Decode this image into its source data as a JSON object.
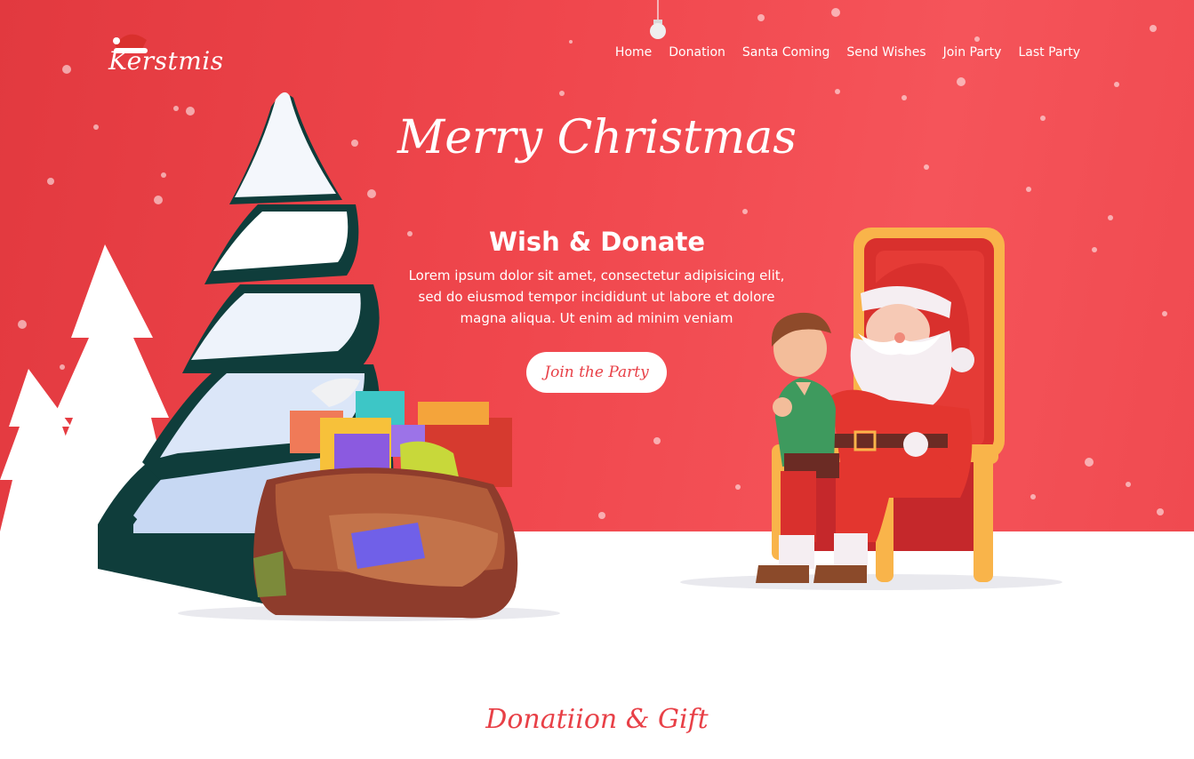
{
  "brand": {
    "name": "Kerstmis"
  },
  "nav": {
    "items": [
      "Home",
      "Donation",
      "Santa Coming",
      "Send Wishes",
      "Join Party",
      "Last Party"
    ]
  },
  "hero": {
    "script_title": "Merry Christmas",
    "title": "Wish & Donate",
    "body": "Lorem ipsum dolor sit amet, consectetur adipisicing elit, sed do eiusmod tempor incididunt ut labore et dolore magna aliqua. Ut enim ad minim veniam",
    "cta_label": "Join the Party"
  },
  "section": {
    "title": "Donatiion & Gift"
  },
  "colors": {
    "hero_red": "#f0474d",
    "accent": "#e84047",
    "white": "#ffffff",
    "tree_green": "#0f3d3b",
    "snow_blue": "#c7d8f3"
  },
  "icons": [
    "santa-hat-icon",
    "ornament-icon"
  ]
}
